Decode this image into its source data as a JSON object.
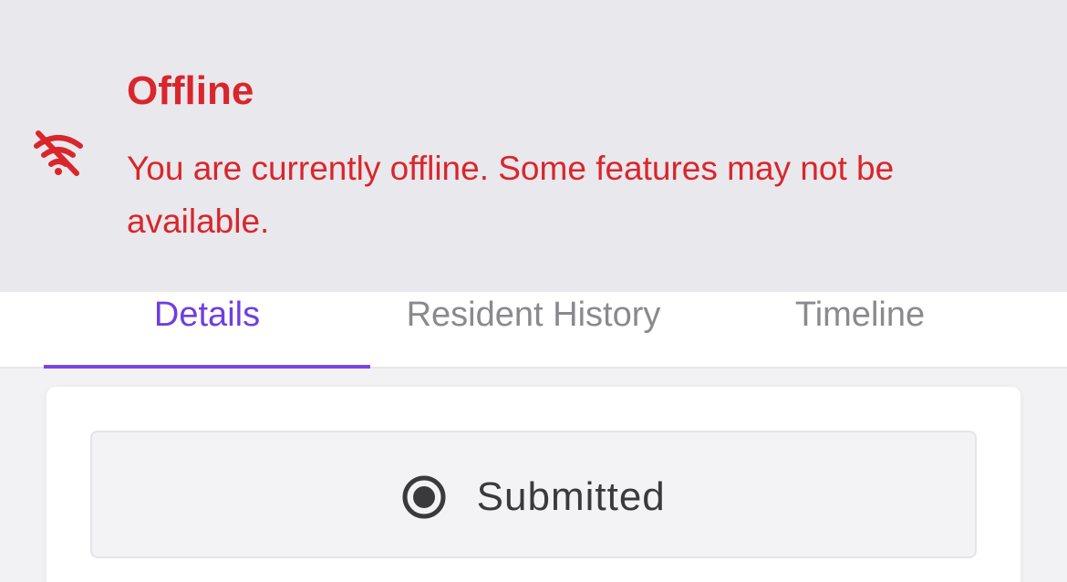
{
  "banner": {
    "title": "Offline",
    "message": "You are currently offline. Some features may not be available.",
    "icon": "wifi-off-icon",
    "color": "#d8262c"
  },
  "tabs": [
    {
      "label": "Details",
      "active": true
    },
    {
      "label": "Resident History",
      "active": false
    },
    {
      "label": "Timeline",
      "active": false
    }
  ],
  "status": {
    "label": "Submitted",
    "icon": "radio-selected-icon"
  },
  "colors": {
    "accent": "#7a45e0",
    "error": "#d8262c"
  }
}
